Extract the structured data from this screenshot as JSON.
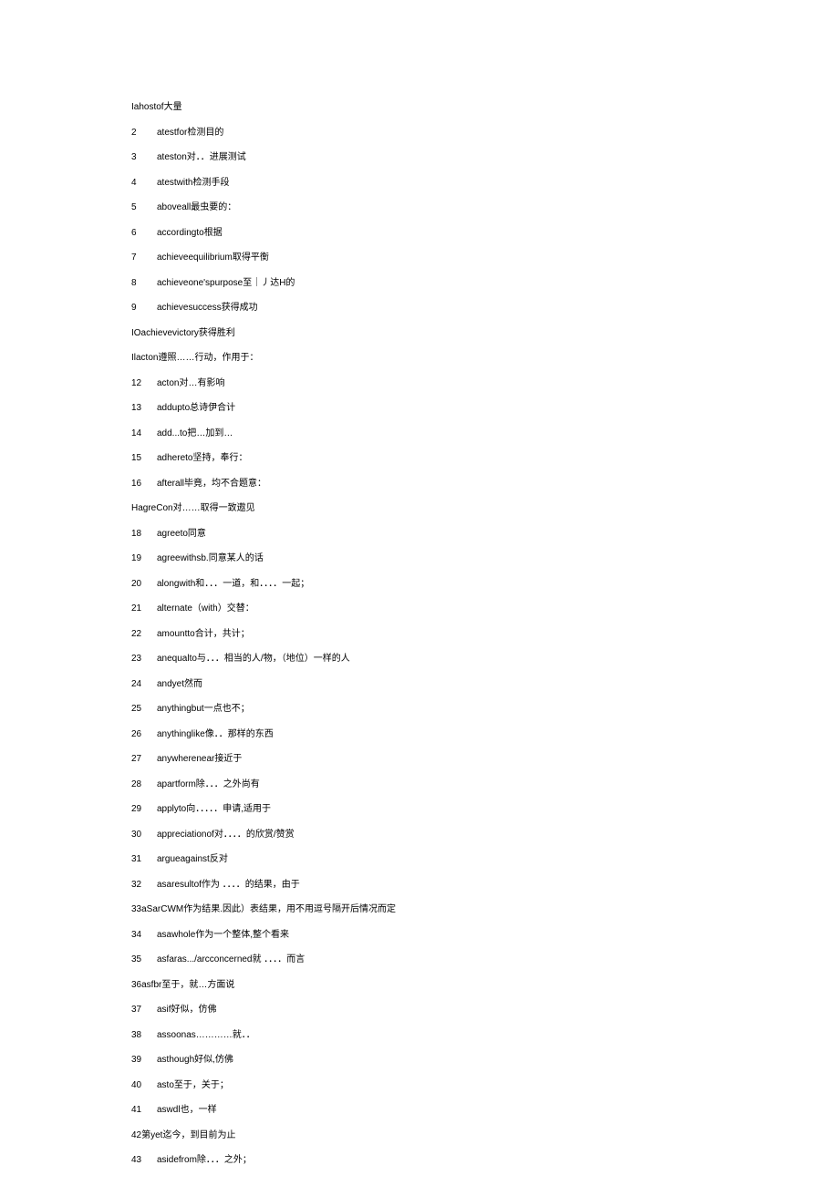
{
  "lines": [
    {
      "raw": "Iahostof大量"
    },
    {
      "num": "2",
      "text": "atestfor检测目的"
    },
    {
      "num": "3",
      "text": "ateston对．．进展测试"
    },
    {
      "num": "4",
      "text": "atestwith检测手段"
    },
    {
      "num": "5",
      "text": "aboveall最虫要的："
    },
    {
      "num": "6",
      "text": "accordingto根据"
    },
    {
      "num": "7",
      "text": "achieveequilibrium取得平衡"
    },
    {
      "num": "8",
      "text": "achieveone'spurpose至｜丿达H的"
    },
    {
      "num": "9",
      "text": "achievesuccess获得成功"
    },
    {
      "raw": "IOachievevictory获得胜利"
    },
    {
      "raw": "Ilacton遵照……行动，作用于："
    },
    {
      "num": "12",
      "text": "acton对…有影响"
    },
    {
      "num": "13",
      "text": "addupto总诗伊合计"
    },
    {
      "num": "14",
      "text": "add...to把…加到…"
    },
    {
      "num": "15",
      "text": "adhereto坚持，奉行："
    },
    {
      "num": "16",
      "text": "afterall毕竟，均不合题意："
    },
    {
      "raw": "HagreCon对……取得一致遨见"
    },
    {
      "num": "18",
      "text": "agreeto同意"
    },
    {
      "num": "19",
      "text": "agreewithsb.同意某人的话"
    },
    {
      "num": "20",
      "text": "alongwith和．．．一道，和．．．．一起；"
    },
    {
      "num": "21",
      "text": "alternate（with）交替："
    },
    {
      "num": "22",
      "text": "amountto合计，共计；"
    },
    {
      "num": "23",
      "text": "anequalto与．．．相当的人/物，（地位）一样的人"
    },
    {
      "num": "24",
      "text": "andyet然而"
    },
    {
      "num": "25",
      "text": "anythingbut一点也不；"
    },
    {
      "num": "26",
      "text": "anythinglike像．．那样的东西"
    },
    {
      "num": "27",
      "text": "anywherenear接近于"
    },
    {
      "num": "28",
      "text": "apartform除．．．之外尚有"
    },
    {
      "num": "29",
      "text": "applyto向．．．．．申请,适用于"
    },
    {
      "num": "30",
      "text": "appreciationof对．．．．的欣赏/赞赏"
    },
    {
      "num": "31",
      "text": "argueagainst反对"
    },
    {
      "num": "32",
      "text": "asaresultof作为 ．．．．的结果，由于"
    },
    {
      "raw": "33aSarCWM作为结果.因此）表结果，用不用逗号隔开后情况而定"
    },
    {
      "num": "34",
      "text": "asawhole作为一个整体,整个看来"
    },
    {
      "num": "35",
      "text": "asfaras.../arcconcerned就 ．．．．而言"
    },
    {
      "raw": "36asfbr至于，就…方面说"
    },
    {
      "num": "37",
      "text": "asif好似，仿佛"
    },
    {
      "num": "38",
      "text": "assoonas…………就．．"
    },
    {
      "num": "39",
      "text": "asthough好似,仿佛"
    },
    {
      "num": "40",
      "text": "asto至于，关于；"
    },
    {
      "num": "41",
      "text": "aswdl也，一样"
    },
    {
      "raw": "42第yet迄今，到目前为止"
    },
    {
      "num": "43",
      "text": "asidefrom除．．．之外；"
    }
  ]
}
